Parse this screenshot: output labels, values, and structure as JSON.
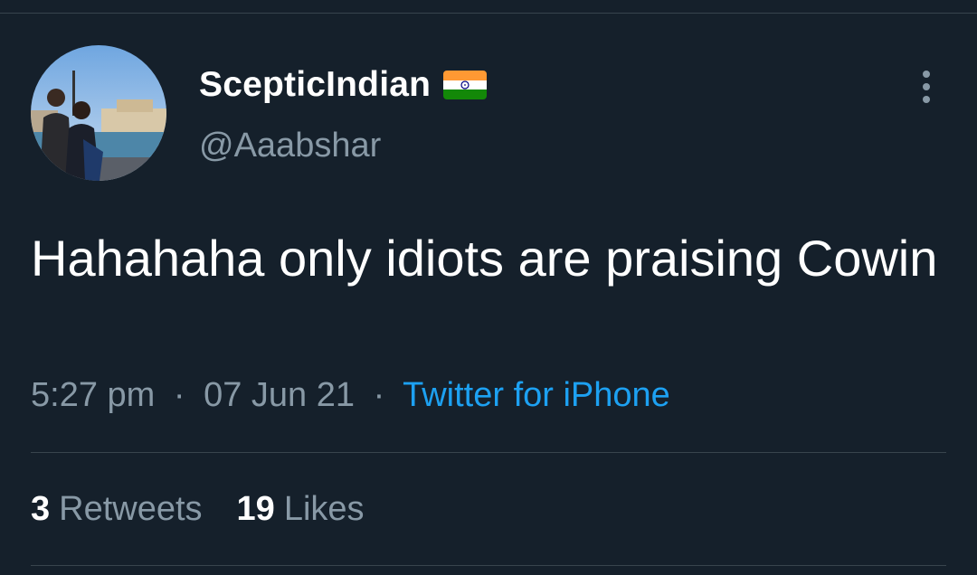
{
  "user": {
    "display_name": "ScepticIndian",
    "handle": "@Aaabshar",
    "flag_icon": "india-flag-icon"
  },
  "tweet": {
    "text": "Hahahaha only idiots are praising Cowin",
    "time": "5:27 pm",
    "separator": "·",
    "date": "07 Jun 21",
    "source": "Twitter for iPhone"
  },
  "stats": {
    "retweets_count": "3",
    "retweets_label": "Retweets",
    "likes_count": "19",
    "likes_label": "Likes"
  },
  "colors": {
    "background": "#15202b",
    "text_primary": "#ffffff",
    "text_secondary": "#8899a6",
    "link": "#1da1f2",
    "divider": "#38444d"
  }
}
